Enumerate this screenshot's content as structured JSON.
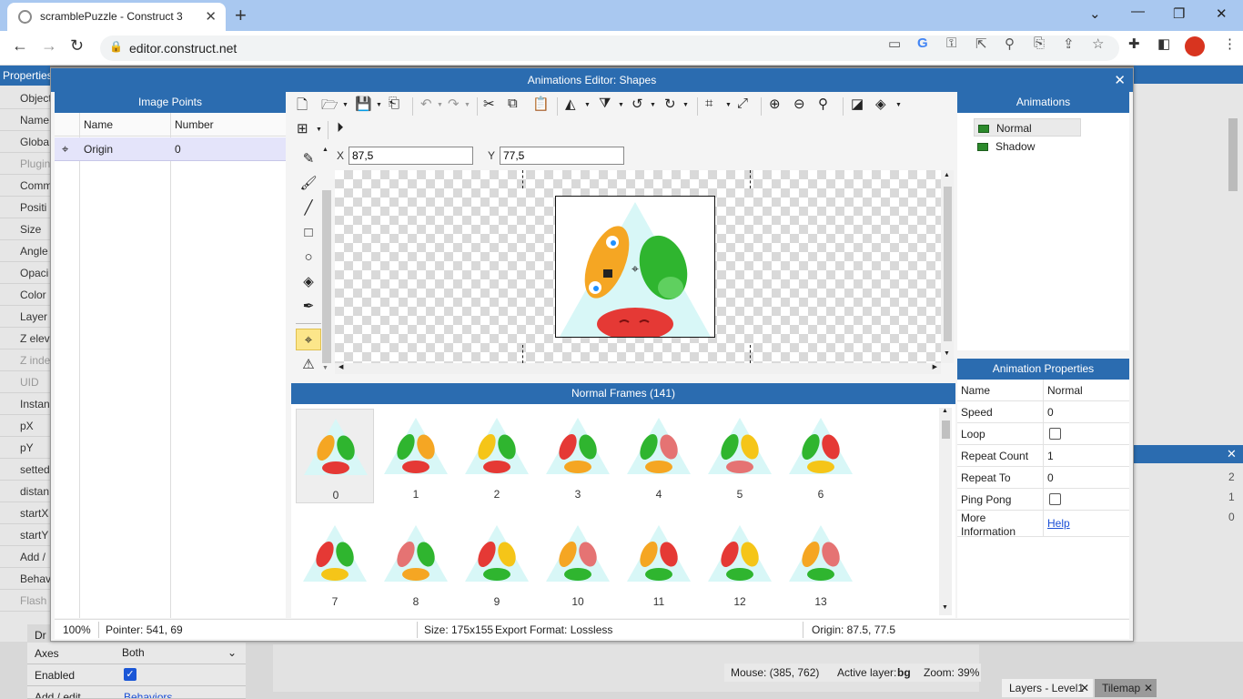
{
  "browser": {
    "tab_title": "scramblePuzzle - Construct 3",
    "new_tab_symbol": "+",
    "url": "editor.construct.net",
    "window_controls": [
      "chevron-down-icon",
      "minimize-icon",
      "restore-icon",
      "close-icon"
    ]
  },
  "background": {
    "properties_title": "Properties",
    "left_rows": [
      "Object",
      "Name",
      "Globa",
      "Plugin",
      "Comm",
      "Positi",
      "Size",
      "Angle",
      "Opaci",
      "Color",
      "Layer",
      "Z elev",
      "Z inde",
      "UID",
      "Instan",
      "pX",
      "pY",
      "setted",
      "distan",
      "startX",
      "startY",
      "Add /",
      "Behav",
      "Flash"
    ],
    "left_dim_rows": [
      3,
      12,
      13,
      23
    ],
    "bottom_rows": [
      {
        "label": "Dr",
        "value": ""
      },
      {
        "label": "Axes",
        "value": "Both"
      },
      {
        "label": "Enabled",
        "value": "✓"
      },
      {
        "label": "Add / edit",
        "value": "Behaviors"
      }
    ],
    "right_numbers": [
      "2",
      "1",
      "0"
    ],
    "mouse": "Mouse: (385, 762)",
    "active_layer_label": "Active layer:",
    "active_layer": "bg",
    "zoom": "Zoom: 39%",
    "bottom_tabs": [
      "Layers - Level1",
      "Tilemap"
    ]
  },
  "dialog": {
    "title": "Animations Editor: Shapes",
    "image_points": {
      "title": "Image Points",
      "columns": [
        "Name",
        "Number"
      ],
      "rows": [
        {
          "name": "Origin",
          "number": "0"
        }
      ]
    },
    "toolbar": {
      "x_label": "X",
      "x_value": "87,5",
      "y_label": "Y",
      "y_value": "77,5"
    },
    "frames": {
      "title": "Normal Frames (141)",
      "items": [
        {
          "label": "0",
          "colors": [
            "#f5a623",
            "#2fb52f",
            "#e53935"
          ]
        },
        {
          "label": "1",
          "colors": [
            "#2fb52f",
            "#f5a623",
            "#e53935"
          ]
        },
        {
          "label": "2",
          "colors": [
            "#f5c518",
            "#2fb52f",
            "#e53935"
          ]
        },
        {
          "label": "3",
          "colors": [
            "#e53935",
            "#2fb52f",
            "#f5a623"
          ]
        },
        {
          "label": "4",
          "colors": [
            "#2fb52f",
            "#e57373",
            "#f5a623"
          ]
        },
        {
          "label": "5",
          "colors": [
            "#2fb52f",
            "#f5c518",
            "#e57373"
          ]
        },
        {
          "label": "6",
          "colors": [
            "#2fb52f",
            "#e53935",
            "#f5c518"
          ]
        },
        {
          "label": "7",
          "colors": [
            "#e53935",
            "#2fb52f",
            "#f5c518"
          ]
        },
        {
          "label": "8",
          "colors": [
            "#e57373",
            "#2fb52f",
            "#f5a623"
          ]
        },
        {
          "label": "9",
          "colors": [
            "#e53935",
            "#f5c518",
            "#2fb52f"
          ]
        },
        {
          "label": "10",
          "colors": [
            "#f5a623",
            "#e57373",
            "#2fb52f"
          ]
        },
        {
          "label": "11",
          "colors": [
            "#f5a623",
            "#e53935",
            "#2fb52f"
          ]
        },
        {
          "label": "12",
          "colors": [
            "#e53935",
            "#f5c518",
            "#2fb52f"
          ]
        },
        {
          "label": "13",
          "colors": [
            "#f5a623",
            "#e57373",
            "#2fb52f"
          ]
        }
      ]
    },
    "animations": {
      "title": "Animations",
      "items": [
        "Normal",
        "Shadow"
      ]
    },
    "animation_properties": {
      "title": "Animation Properties",
      "rows": [
        {
          "name": "Name",
          "value": "Normal",
          "type": "text"
        },
        {
          "name": "Speed",
          "value": "0",
          "type": "text"
        },
        {
          "name": "Loop",
          "value": "",
          "type": "check"
        },
        {
          "name": "Repeat Count",
          "value": "1",
          "type": "text"
        },
        {
          "name": "Repeat To",
          "value": "0",
          "type": "text"
        },
        {
          "name": "Ping Pong",
          "value": "",
          "type": "check"
        },
        {
          "name": "More Information",
          "value": "Help",
          "type": "link"
        }
      ]
    },
    "status": {
      "zoom": "100%",
      "pointer": "Pointer: 541, 69",
      "size": "Size: 175x155",
      "export": "Export Format: Lossless",
      "origin": "Origin: 87.5, 77.5"
    }
  }
}
